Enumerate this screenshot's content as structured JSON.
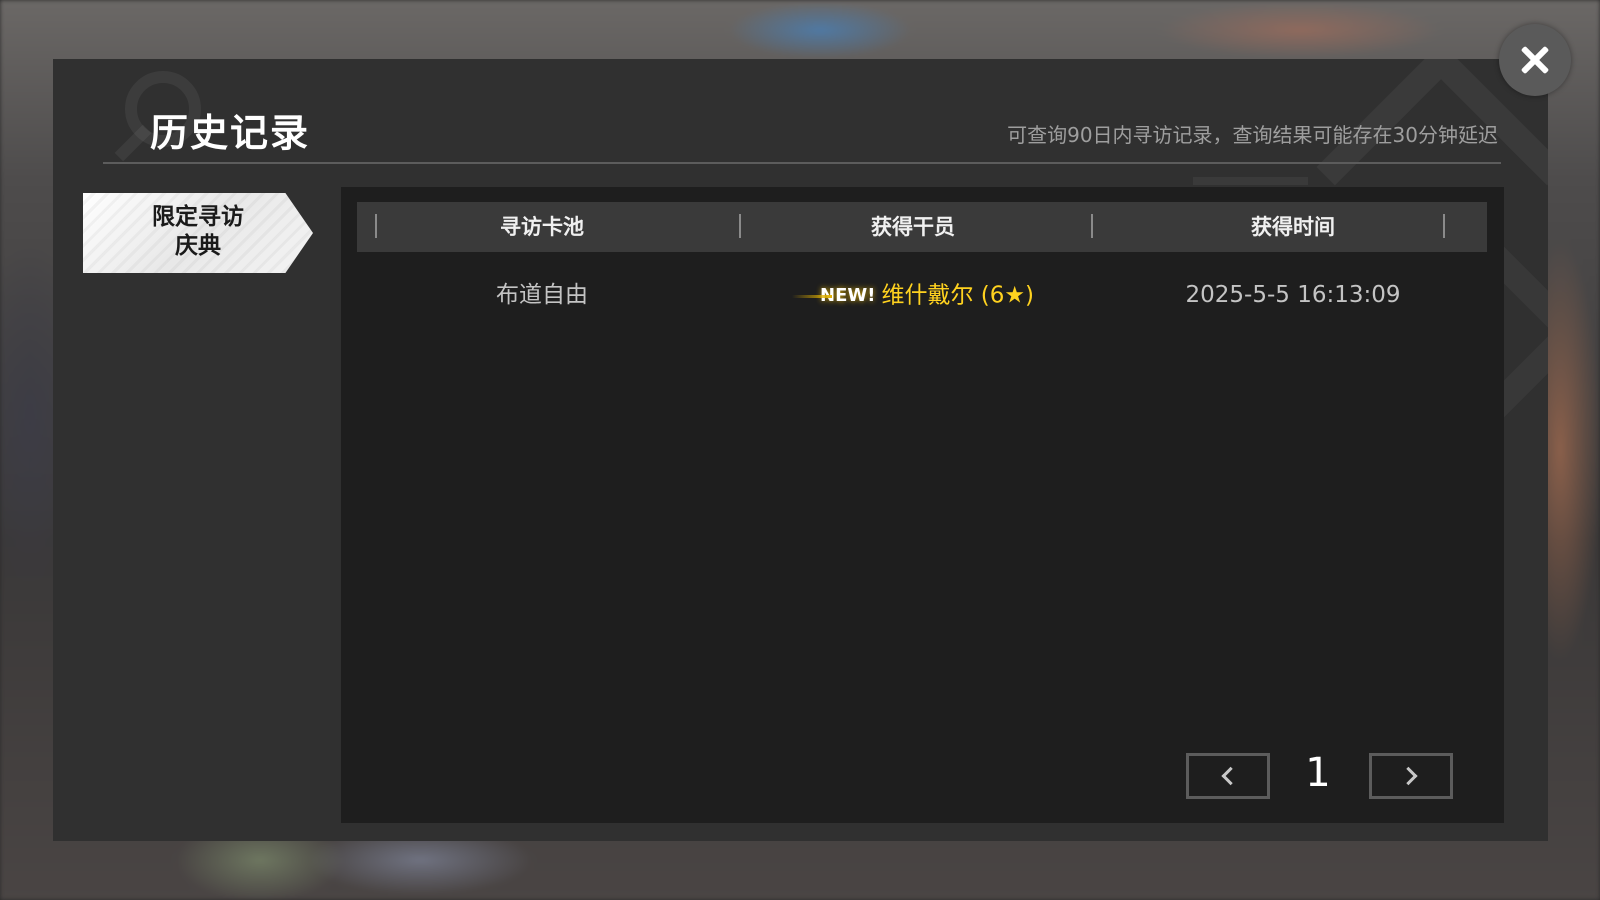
{
  "header": {
    "title": "历史记录",
    "subtitle": "可查询90日内寻访记录，查询结果可能存在30分钟延迟"
  },
  "sidebar": {
    "tabs": [
      {
        "label": "限定寻访\n庆典",
        "selected": true
      }
    ]
  },
  "table": {
    "columns": [
      "寻访卡池",
      "获得干员",
      "获得时间"
    ],
    "rows": [
      {
        "pool": "布道自由",
        "badge": "NEW!",
        "operator": "维什戴尔 (6★)",
        "time": "2025-5-5 16:13:09"
      }
    ]
  },
  "pagination": {
    "current_page": "1"
  },
  "icons": {
    "close": "close-icon",
    "prev": "chevron-left-icon",
    "next": "chevron-right-icon"
  },
  "colors": {
    "operator_highlight": "#ffd21f",
    "panel_bg": "#1e1e1e",
    "modal_bg": "#303030"
  }
}
